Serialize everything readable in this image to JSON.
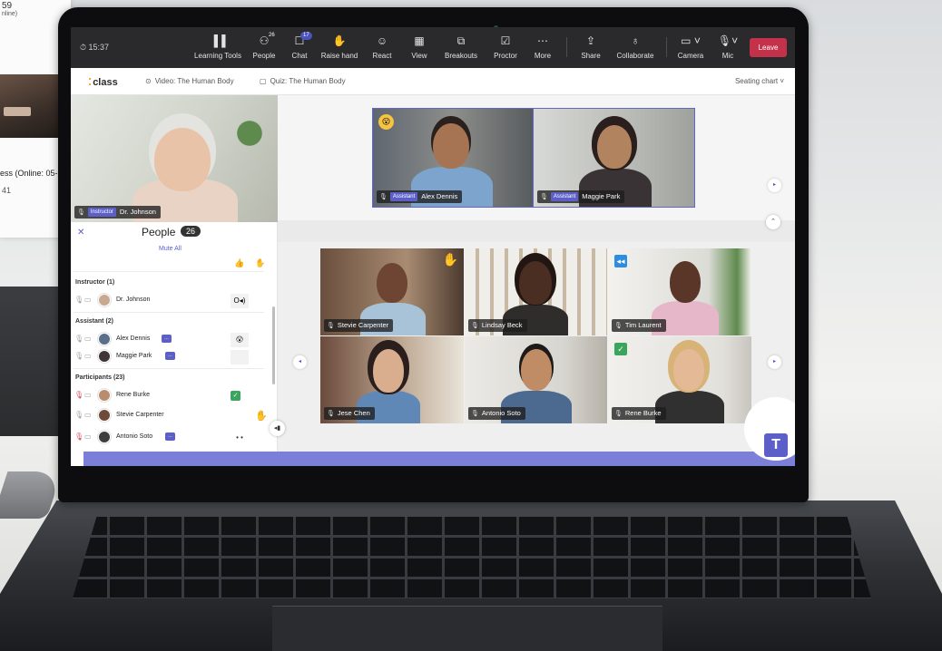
{
  "background": {
    "card_number": "59",
    "card_online": "nline)",
    "card_progress": "ess (Online: 05-",
    "card_value": "41"
  },
  "toolbar": {
    "clock": "15:37",
    "items": [
      {
        "label": "Learning Tools",
        "icon": "bar-chart-icon"
      },
      {
        "label": "People",
        "icon": "people-icon",
        "count": "26"
      },
      {
        "label": "Chat",
        "icon": "chat-icon",
        "count": "17"
      },
      {
        "label": "Raise hand",
        "icon": "hand-icon"
      },
      {
        "label": "React",
        "icon": "smile-icon"
      },
      {
        "label": "View",
        "icon": "grid-icon"
      },
      {
        "label": "Breakouts",
        "icon": "breakout-icon"
      },
      {
        "label": "Proctor",
        "icon": "proctor-icon"
      },
      {
        "label": "More",
        "icon": "ellipsis-icon"
      },
      {
        "label": "Share",
        "icon": "share-icon"
      },
      {
        "label": "Collaborate",
        "icon": "lightbulb-icon"
      },
      {
        "label": "Camera",
        "icon": "camera-icon"
      },
      {
        "label": "Mic",
        "icon": "mic-icon"
      }
    ],
    "leave": "Leave"
  },
  "appbar": {
    "brand": "class",
    "tabs": [
      {
        "label": "Video: The Human Body",
        "icon": "play-icon"
      },
      {
        "label": "Quiz: The Human Body",
        "icon": "document-icon"
      }
    ],
    "seating": "Seating chart"
  },
  "instructor": {
    "role": "Instructor",
    "name": "Dr. Johnson"
  },
  "spotlight": [
    {
      "role": "Assistant",
      "name": "Alex Dennis",
      "reaction": "😮"
    },
    {
      "role": "Assistant",
      "name": "Maggie Park"
    }
  ],
  "grid": [
    {
      "name": "Stevie Carpenter",
      "raised_hand": true
    },
    {
      "name": "Lindsay Beck"
    },
    {
      "name": "Tim Laurent",
      "badge": "rewind"
    },
    {
      "name": "Jese Chen"
    },
    {
      "name": "Antonio Soto"
    },
    {
      "name": "Rene Burke",
      "badge": "check"
    }
  ],
  "people": {
    "title": "People",
    "count": "26",
    "mute_all": "Mute All",
    "sections": [
      {
        "title": "Instructor (1)",
        "members": [
          {
            "name": "Dr. Johnson",
            "status": "O◂)"
          }
        ]
      },
      {
        "title": "Assistant (2)",
        "members": [
          {
            "name": "Alex Dennis",
            "status": "😮"
          },
          {
            "name": "Maggie Park"
          }
        ]
      },
      {
        "title": "Participants (23)",
        "members": [
          {
            "name": "Rene Burke",
            "status": "✓"
          },
          {
            "name": "Stevie Carpenter",
            "status": "✋"
          },
          {
            "name": "Antonio Soto",
            "status": "• •"
          }
        ]
      }
    ]
  },
  "colors": {
    "accent": "#5b5fc7",
    "leave": "#c4314b",
    "toolbar": "#2a2a2c",
    "reaction": "#f6c343"
  },
  "teams_logo": "T"
}
